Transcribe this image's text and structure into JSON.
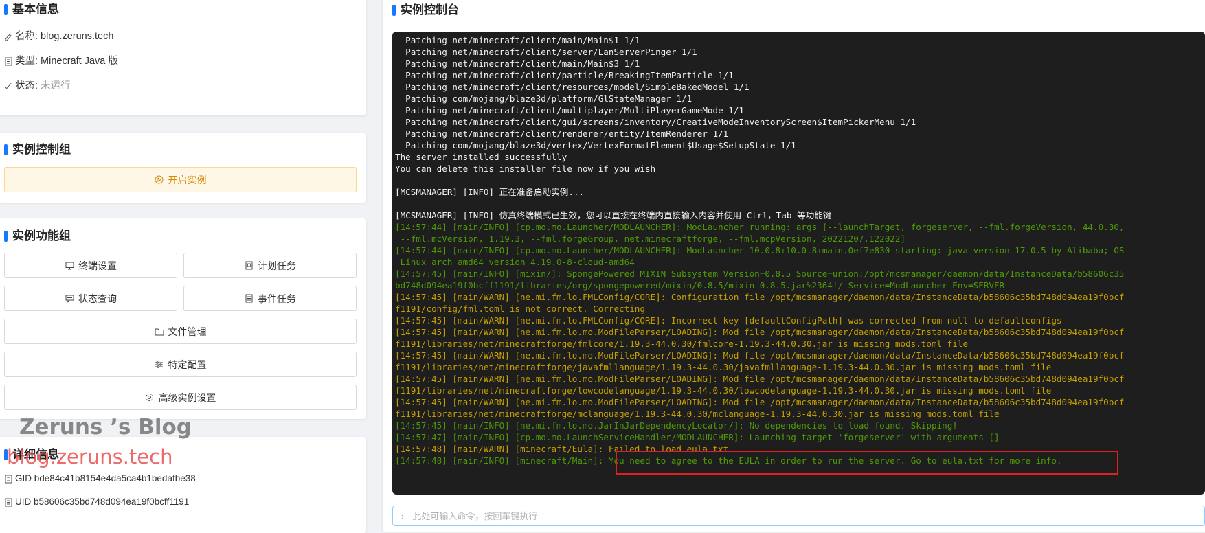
{
  "basic_info": {
    "title": "基本信息",
    "name_label": "名称: ",
    "name_value": "blog.zeruns.tech",
    "type_label": "类型: ",
    "type_value": "Minecraft Java 版",
    "status_label": "状态: ",
    "status_value": "未运行"
  },
  "control_group": {
    "title": "实例控制组",
    "start_button": "开启实例"
  },
  "function_group": {
    "title": "实例功能组",
    "terminal_settings": "终端设置",
    "scheduled_tasks": "计划任务",
    "status_query": "状态查询",
    "event_tasks": "事件任务",
    "file_manager": "文件管理",
    "specific_config": "特定配置",
    "advanced_settings": "高级实例设置"
  },
  "watermark": {
    "line1": "Zeruns ’s Blog",
    "line2": "blog.zeruns.tech"
  },
  "details": {
    "title": "详细信息",
    "gid": "GID bde84c41b8154e4da5ca4b1bedafbe38",
    "uid": "UID b58606c35bd748d094ea19f0bcff1191"
  },
  "console": {
    "title": "实例控制台",
    "input_placeholder": "此处可输入命令，按回车键执行",
    "lines": [
      {
        "text": "  Patching net/minecraft/client/main/Main$1 1/1",
        "color": "white"
      },
      {
        "text": "  Patching net/minecraft/client/server/LanServerPinger 1/1",
        "color": "white"
      },
      {
        "text": "  Patching net/minecraft/client/main/Main$3 1/1",
        "color": "white"
      },
      {
        "text": "  Patching net/minecraft/client/particle/BreakingItemParticle 1/1",
        "color": "white"
      },
      {
        "text": "  Patching net/minecraft/client/resources/model/SimpleBakedModel 1/1",
        "color": "white"
      },
      {
        "text": "  Patching com/mojang/blaze3d/platform/GlStateManager 1/1",
        "color": "white"
      },
      {
        "text": "  Patching net/minecraft/client/multiplayer/MultiPlayerGameMode 1/1",
        "color": "white"
      },
      {
        "text": "  Patching net/minecraft/client/gui/screens/inventory/CreativeModeInventoryScreen$ItemPickerMenu 1/1",
        "color": "white"
      },
      {
        "text": "  Patching net/minecraft/client/renderer/entity/ItemRenderer 1/1",
        "color": "white"
      },
      {
        "text": "  Patching com/mojang/blaze3d/vertex/VertexFormatElement$Usage$SetupState 1/1",
        "color": "white"
      },
      {
        "text": "The server installed successfully",
        "color": "white"
      },
      {
        "text": "You can delete this installer file now if you wish",
        "color": "white"
      },
      {
        "text": "",
        "color": "white"
      },
      {
        "text": "[MCSMANAGER] [INFO] 正在准备启动实例...",
        "color": "white"
      },
      {
        "text": "",
        "color": "white"
      },
      {
        "text": "[MCSMANAGER] [INFO] 仿真终端模式已生效，您可以直接在终端内直接输入内容并使用 Ctrl，Tab 等功能键",
        "color": "white"
      },
      {
        "text": "[14:57:44] [main/INFO] [cp.mo.mo.Launcher/MODLAUNCHER]: ModLauncher running: args [--launchTarget, forgeserver, --fml.forgeVersion, 44.0.30,",
        "color": "green"
      },
      {
        "text": " --fml.mcVersion, 1.19.3, --fml.forgeGroup, net.minecraftforge, --fml.mcpVersion, 20221207.122022]",
        "color": "green"
      },
      {
        "text": "[14:57:44] [main/INFO] [cp.mo.mo.Launcher/MODLAUNCHER]: ModLauncher 10.0.8+10.0.8+main.0ef7e830 starting: java version 17.0.5 by Alibaba; OS",
        "color": "green"
      },
      {
        "text": " Linux arch amd64 version 4.19.0-8-cloud-amd64",
        "color": "green"
      },
      {
        "text": "[14:57:45] [main/INFO] [mixin/]: SpongePowered MIXIN Subsystem Version=0.8.5 Source=union:/opt/mcsmanager/daemon/data/InstanceData/b58606c35",
        "color": "green"
      },
      {
        "text": "bd748d094ea19f0bcff1191/libraries/org/spongepowered/mixin/0.8.5/mixin-0.8.5.jar%2364!/ Service=ModLauncher Env=SERVER",
        "color": "green"
      },
      {
        "text": "[14:57:45] [main/WARN] [ne.mi.fm.lo.FMLConfig/CORE]: Configuration file /opt/mcsmanager/daemon/data/InstanceData/b58606c35bd748d094ea19f0bcf",
        "color": "yellow"
      },
      {
        "text": "f1191/config/fml.toml is not correct. Correcting",
        "color": "yellow"
      },
      {
        "text": "[14:57:45] [main/WARN] [ne.mi.fm.lo.FMLConfig/CORE]: Incorrect key [defaultConfigPath] was corrected from null to defaultconfigs",
        "color": "yellow"
      },
      {
        "text": "[14:57:45] [main/WARN] [ne.mi.fm.lo.mo.ModFileParser/LOADING]: Mod file /opt/mcsmanager/daemon/data/InstanceData/b58606c35bd748d094ea19f0bcf",
        "color": "yellow"
      },
      {
        "text": "f1191/libraries/net/minecraftforge/fmlcore/1.19.3-44.0.30/fmlcore-1.19.3-44.0.30.jar is missing mods.toml file",
        "color": "yellow"
      },
      {
        "text": "[14:57:45] [main/WARN] [ne.mi.fm.lo.mo.ModFileParser/LOADING]: Mod file /opt/mcsmanager/daemon/data/InstanceData/b58606c35bd748d094ea19f0bcf",
        "color": "yellow"
      },
      {
        "text": "f1191/libraries/net/minecraftforge/javafmllanguage/1.19.3-44.0.30/javafmllanguage-1.19.3-44.0.30.jar is missing mods.toml file",
        "color": "yellow"
      },
      {
        "text": "[14:57:45] [main/WARN] [ne.mi.fm.lo.mo.ModFileParser/LOADING]: Mod file /opt/mcsmanager/daemon/data/InstanceData/b58606c35bd748d094ea19f0bcf",
        "color": "yellow"
      },
      {
        "text": "f1191/libraries/net/minecraftforge/lowcodelanguage/1.19.3-44.0.30/lowcodelanguage-1.19.3-44.0.30.jar is missing mods.toml file",
        "color": "yellow"
      },
      {
        "text": "[14:57:45] [main/WARN] [ne.mi.fm.lo.mo.ModFileParser/LOADING]: Mod file /opt/mcsmanager/daemon/data/InstanceData/b58606c35bd748d094ea19f0bcf",
        "color": "yellow"
      },
      {
        "text": "f1191/libraries/net/minecraftforge/mclanguage/1.19.3-44.0.30/mclanguage-1.19.3-44.0.30.jar is missing mods.toml file",
        "color": "yellow"
      },
      {
        "text": "[14:57:45] [main/INFO] [ne.mi.fm.lo.mo.JarInJarDependencyLocator/]: No dependencies to load found. Skipping!",
        "color": "green"
      },
      {
        "text": "[14:57:47] [main/INFO] [cp.mo.mo.LaunchServiceHandler/MODLAUNCHER]: Launching target 'forgeserver' with arguments []",
        "color": "green"
      },
      {
        "text": "[14:57:48] [main/WARN] [minecraft/Eula]: Failed to load eula.txt",
        "color": "yellow"
      },
      {
        "text": "[14:57:48] [main/INFO] [minecraft/Main]: You need to agree to the EULA in order to run the server. Go to eula.txt for more info.",
        "color": "green"
      },
      {
        "text": "_",
        "color": "white"
      }
    ]
  },
  "colors": {
    "accent": "#1677ff",
    "console_bg": "#1e1e1e",
    "info_green": "#4e9a06",
    "warn_yellow": "#c4a000",
    "highlight_red": "#e02020"
  }
}
